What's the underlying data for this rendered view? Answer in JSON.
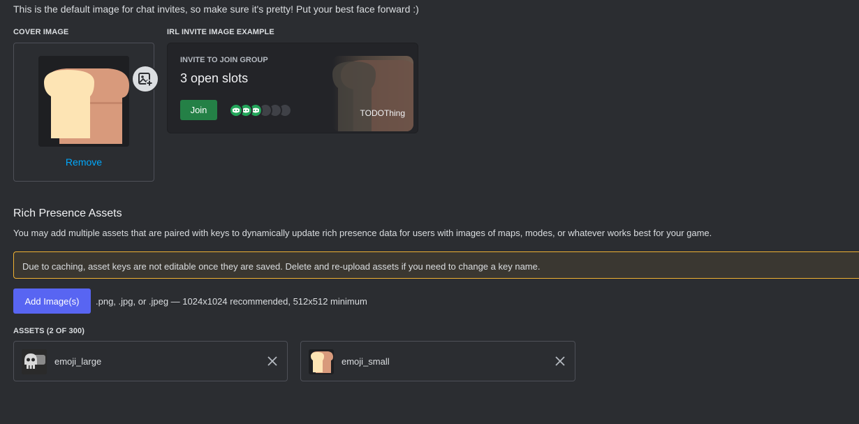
{
  "intro": "This is the default image for chat invites, so make sure it's pretty! Put your best face forward :)",
  "cover": {
    "label": "COVER IMAGE",
    "remove": "Remove",
    "add_icon": "image-add-icon"
  },
  "irl": {
    "label": "IRL INVITE IMAGE EXAMPLE",
    "title": "INVITE TO JOIN GROUP",
    "slots": "3 open slots",
    "join": "Join",
    "game": "TODOThing",
    "filled_slots": 3,
    "total_slots": 6
  },
  "rich_presence": {
    "title": "Rich Presence Assets",
    "description": "You may add multiple assets that are paired with keys to dynamically update rich presence data for users with images of maps, modes, or whatever works best for your game.",
    "warning": "Due to caching, asset keys are not editable once they are saved. Delete and re-upload assets if you need to change a key name.",
    "add_button": "Add Image(s)",
    "hint": ".png, .jpg, or .jpeg — 1024x1024 recommended, 512x512 minimum",
    "assets_label": "ASSETS (2 OF 300)",
    "assets": [
      {
        "name": "emoji_large",
        "icon": "skull-emoji-icon"
      },
      {
        "name": "emoji_small",
        "icon": "bread-emoji-icon"
      }
    ]
  },
  "colors": {
    "background": "#2b2d31",
    "accent": "#5865f2",
    "join_green": "#248046",
    "link_blue": "#00a8fc",
    "warning_border": "#f0b232"
  }
}
